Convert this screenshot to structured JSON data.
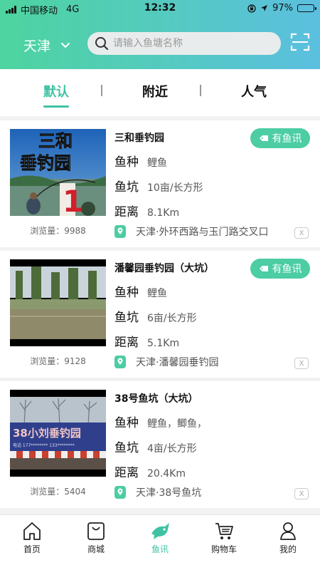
{
  "status_bar": {
    "carrier": "中国移动",
    "network": "4G",
    "time": "12:32",
    "battery": "97%",
    "battery_level": 0.97
  },
  "header": {
    "city": "天津",
    "search_placeholder": "请输入鱼塘名称"
  },
  "tabs": [
    {
      "label": "默认",
      "active": true
    },
    {
      "label": "附近",
      "active": false
    },
    {
      "label": "人气",
      "active": false
    }
  ],
  "labels": {
    "species": "鱼种",
    "pit": "鱼坑",
    "distance": "距离",
    "views": "浏览量：",
    "badge": "有鱼讯",
    "close": "X"
  },
  "ponds": [
    {
      "name": "三和垂钓园",
      "species": "鲤鱼",
      "pit": "10亩/长方形",
      "distance": "8.1Km",
      "views": "9988",
      "address": "天津·外环西路与玉门路交叉口",
      "badge": true,
      "sign_text": "三和垂钓园",
      "sign_number": "1"
    },
    {
      "name": "潘馨园垂钓园（大坑）",
      "species": "鲤鱼",
      "pit": "6亩/长方形",
      "distance": "5.1Km",
      "views": "9128",
      "address": "天津·潘馨园垂钓园",
      "badge": true
    },
    {
      "name": "38号鱼坑（大坑）",
      "species": "鲤鱼，鲫鱼，",
      "pit": "4亩/长方形",
      "distance": "20.4Km",
      "views": "5404",
      "address": "天津·38号鱼坑",
      "badge": false,
      "sign_text": "38小刘垂钓园"
    }
  ],
  "tabbar": [
    {
      "label": "首页",
      "icon": "home-icon",
      "active": false
    },
    {
      "label": "商城",
      "icon": "shop-bag-icon",
      "active": false
    },
    {
      "label": "鱼讯",
      "icon": "fish-icon",
      "active": true
    },
    {
      "label": "购物车",
      "icon": "cart-icon",
      "active": false
    },
    {
      "label": "我的",
      "icon": "profile-icon",
      "active": false
    }
  ],
  "colors": {
    "accent": "#3fc2a3",
    "badge": "#4ccda3",
    "header_start": "#4dd49f",
    "header_end": "#5bbfe0"
  }
}
